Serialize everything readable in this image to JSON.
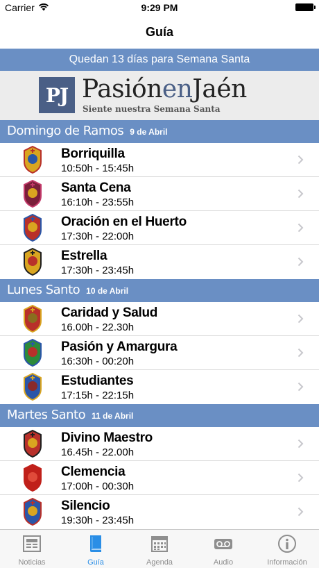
{
  "status_bar": {
    "carrier": "Carrier",
    "time": "9:29 PM",
    "wifi_icon": "wifi-icon",
    "battery_icon": "battery-icon"
  },
  "nav": {
    "title": "Guía"
  },
  "countdown": {
    "text": "Quedan 13 días para Semana Santa"
  },
  "banner": {
    "logo_letters": "PJ",
    "title_part1": "Pasión",
    "title_part2": "en",
    "title_part3": "Jaén",
    "subtitle": "Siente nuestra Semana Santa"
  },
  "sections": [
    {
      "day": "Domingo de Ramos",
      "date": "9 de Abril",
      "rows": [
        {
          "name": "Borriquilla",
          "time": "10:50h - 15:45h",
          "icon": "brotherhood-emblem-icon"
        },
        {
          "name": "Santa Cena",
          "time": "16:10h - 23:55h",
          "icon": "brotherhood-emblem-icon"
        },
        {
          "name": "Oración en el Huerto",
          "time": "17:30h - 22:00h",
          "icon": "brotherhood-emblem-icon"
        },
        {
          "name": "Estrella",
          "time": "17:30h - 23:45h",
          "icon": "brotherhood-emblem-icon"
        }
      ]
    },
    {
      "day": "Lunes Santo",
      "date": "10 de Abril",
      "rows": [
        {
          "name": "Caridad y Salud",
          "time": "16.00h - 22.30h",
          "icon": "brotherhood-emblem-icon"
        },
        {
          "name": "Pasión y Amargura",
          "time": "16:30h - 00:20h",
          "icon": "brotherhood-emblem-icon"
        },
        {
          "name": "Estudiantes",
          "time": "17:15h - 22:15h",
          "icon": "brotherhood-emblem-icon"
        }
      ]
    },
    {
      "day": "Martes Santo",
      "date": "11 de Abril",
      "rows": [
        {
          "name": "Divino Maestro",
          "time": "16.45h - 22.00h",
          "icon": "brotherhood-emblem-icon"
        },
        {
          "name": "Clemencia",
          "time": "17:00h - 00:30h",
          "icon": "brotherhood-emblem-icon"
        },
        {
          "name": "Silencio",
          "time": "19:30h - 23:45h",
          "icon": "brotherhood-emblem-icon"
        }
      ]
    }
  ],
  "tabs": [
    {
      "label": "Noticias",
      "icon": "newspaper-icon",
      "active": false
    },
    {
      "label": "Guía",
      "icon": "book-icon",
      "active": true
    },
    {
      "label": "Agenda",
      "icon": "calendar-icon",
      "active": false
    },
    {
      "label": "Audio",
      "icon": "voicemail-icon",
      "active": false
    },
    {
      "label": "Información",
      "icon": "info-icon",
      "active": false
    }
  ],
  "colors": {
    "section_header": "#6a8fc4",
    "tab_active": "#2a8ee6",
    "tab_inactive": "#8e8e8e",
    "logo_blue": "#4a5f86"
  }
}
